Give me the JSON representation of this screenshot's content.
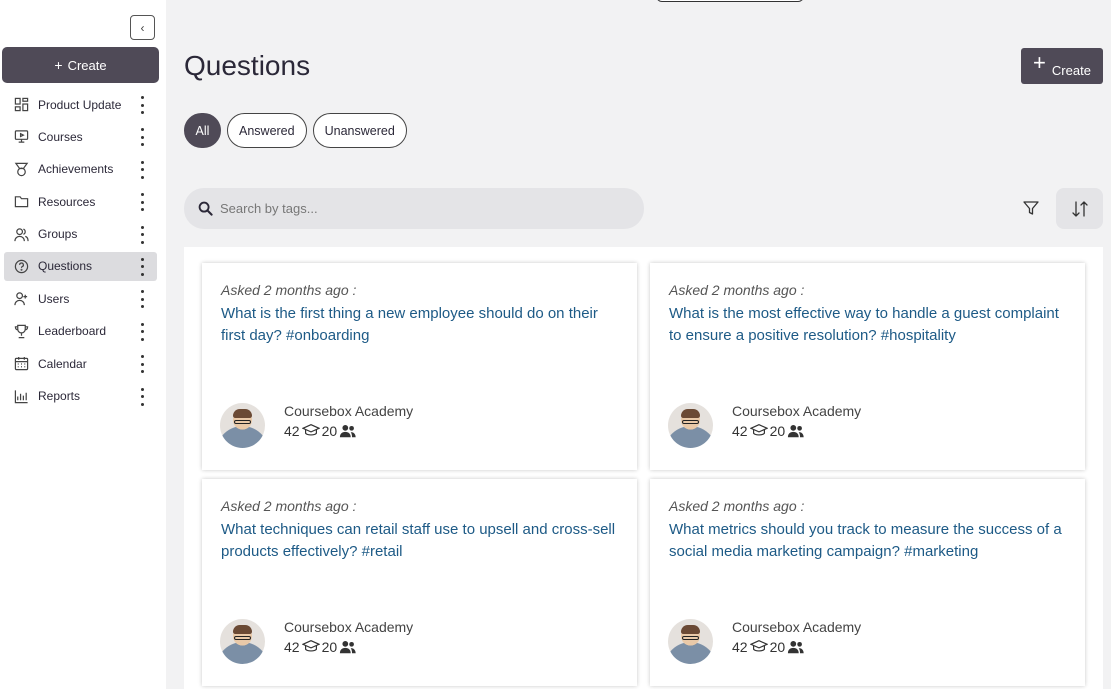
{
  "sidebar": {
    "collapse_icon": "chevron-left-icon",
    "create_label": "Create",
    "items": [
      {
        "label": "Product Update",
        "icon": "grid-icon"
      },
      {
        "label": "Courses",
        "icon": "monitor-icon"
      },
      {
        "label": "Achievements",
        "icon": "medal-icon"
      },
      {
        "label": "Resources",
        "icon": "folder-icon"
      },
      {
        "label": "Groups",
        "icon": "users-icon"
      },
      {
        "label": "Questions",
        "icon": "help-circle-icon",
        "active": true
      },
      {
        "label": "Users",
        "icon": "user-plus-icon"
      },
      {
        "label": "Leaderboard",
        "icon": "trophy-icon"
      },
      {
        "label": "Calendar",
        "icon": "calendar-icon"
      },
      {
        "label": "Reports",
        "icon": "bar-chart-icon"
      }
    ]
  },
  "header": {
    "title": "Questions",
    "create_label": "Create"
  },
  "filters": {
    "all": "All",
    "answered": "Answered",
    "unanswered": "Unanswered"
  },
  "search": {
    "placeholder": "Search by tags..."
  },
  "colors": {
    "primary": "#4f4a57",
    "link": "#1d5a86",
    "background": "#f2f2f3"
  },
  "cards": [
    {
      "asked": "Asked 2 months ago :",
      "question": "What is the first thing a new employee should do on their first day? #onboarding",
      "author": "Coursebox Academy",
      "stat_a": "42",
      "stat_b": "20"
    },
    {
      "asked": "Asked 2 months ago :",
      "question": "What is the most effective way to handle a guest complaint to ensure a positive resolution? #hospitality",
      "author": "Coursebox Academy",
      "stat_a": "42",
      "stat_b": "20"
    },
    {
      "asked": "Asked 2 months ago :",
      "question": "What techniques can retail staff use to upsell and cross-sell products effectively? #retail",
      "author": "Coursebox Academy",
      "stat_a": "42",
      "stat_b": "20"
    },
    {
      "asked": "Asked 2 months ago :",
      "question": "What metrics should you track to measure the success of a social media marketing campaign? #marketing",
      "author": "Coursebox Academy",
      "stat_a": "42",
      "stat_b": "20"
    }
  ]
}
